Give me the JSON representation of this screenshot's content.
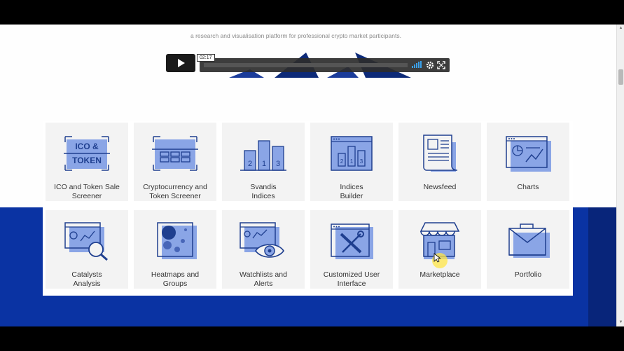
{
  "page": {
    "tagline": "a research and visualisation platform for professional crypto market participants."
  },
  "video": {
    "time": "02:17",
    "icons": {
      "play": "play-icon",
      "volume": "volume-icon",
      "settings": "gear-icon",
      "fullscreen": "fullscreen-icon"
    }
  },
  "features": [
    {
      "label": "ICO and Token Sale\nScreener",
      "icon": "ico-token-icon",
      "icon_text": [
        "ICO &",
        "TOKEN"
      ]
    },
    {
      "label": "Cryptocurrency and\nToken Screener",
      "icon": "token-screener-icon"
    },
    {
      "label": "Svandis\nIndices",
      "icon": "indices-bars-icon",
      "icon_text": [
        "2",
        "1",
        "3"
      ]
    },
    {
      "label": "Indices\nBuilder",
      "icon": "indices-builder-icon",
      "icon_text": [
        "2",
        "1",
        "3"
      ]
    },
    {
      "label": "Newsfeed",
      "icon": "newspaper-icon"
    },
    {
      "label": "Charts",
      "icon": "chart-icon"
    },
    {
      "label": "Catalysts\nAnalysis",
      "icon": "magnifier-chart-icon"
    },
    {
      "label": "Heatmaps and\nGroups",
      "icon": "heatmap-icon"
    },
    {
      "label": "Watchlists and\nAlerts",
      "icon": "eye-chart-icon"
    },
    {
      "label": "Customized User\nInterface",
      "icon": "tools-icon"
    },
    {
      "label": "Marketplace",
      "icon": "storefront-icon"
    },
    {
      "label": "Portfolio",
      "icon": "briefcase-icon"
    }
  ],
  "colors": {
    "accent": "#0a33a3",
    "icon_fill": "#7b98e0",
    "icon_stroke": "#1f3f8f",
    "card_bg": "#f3f3f3"
  }
}
